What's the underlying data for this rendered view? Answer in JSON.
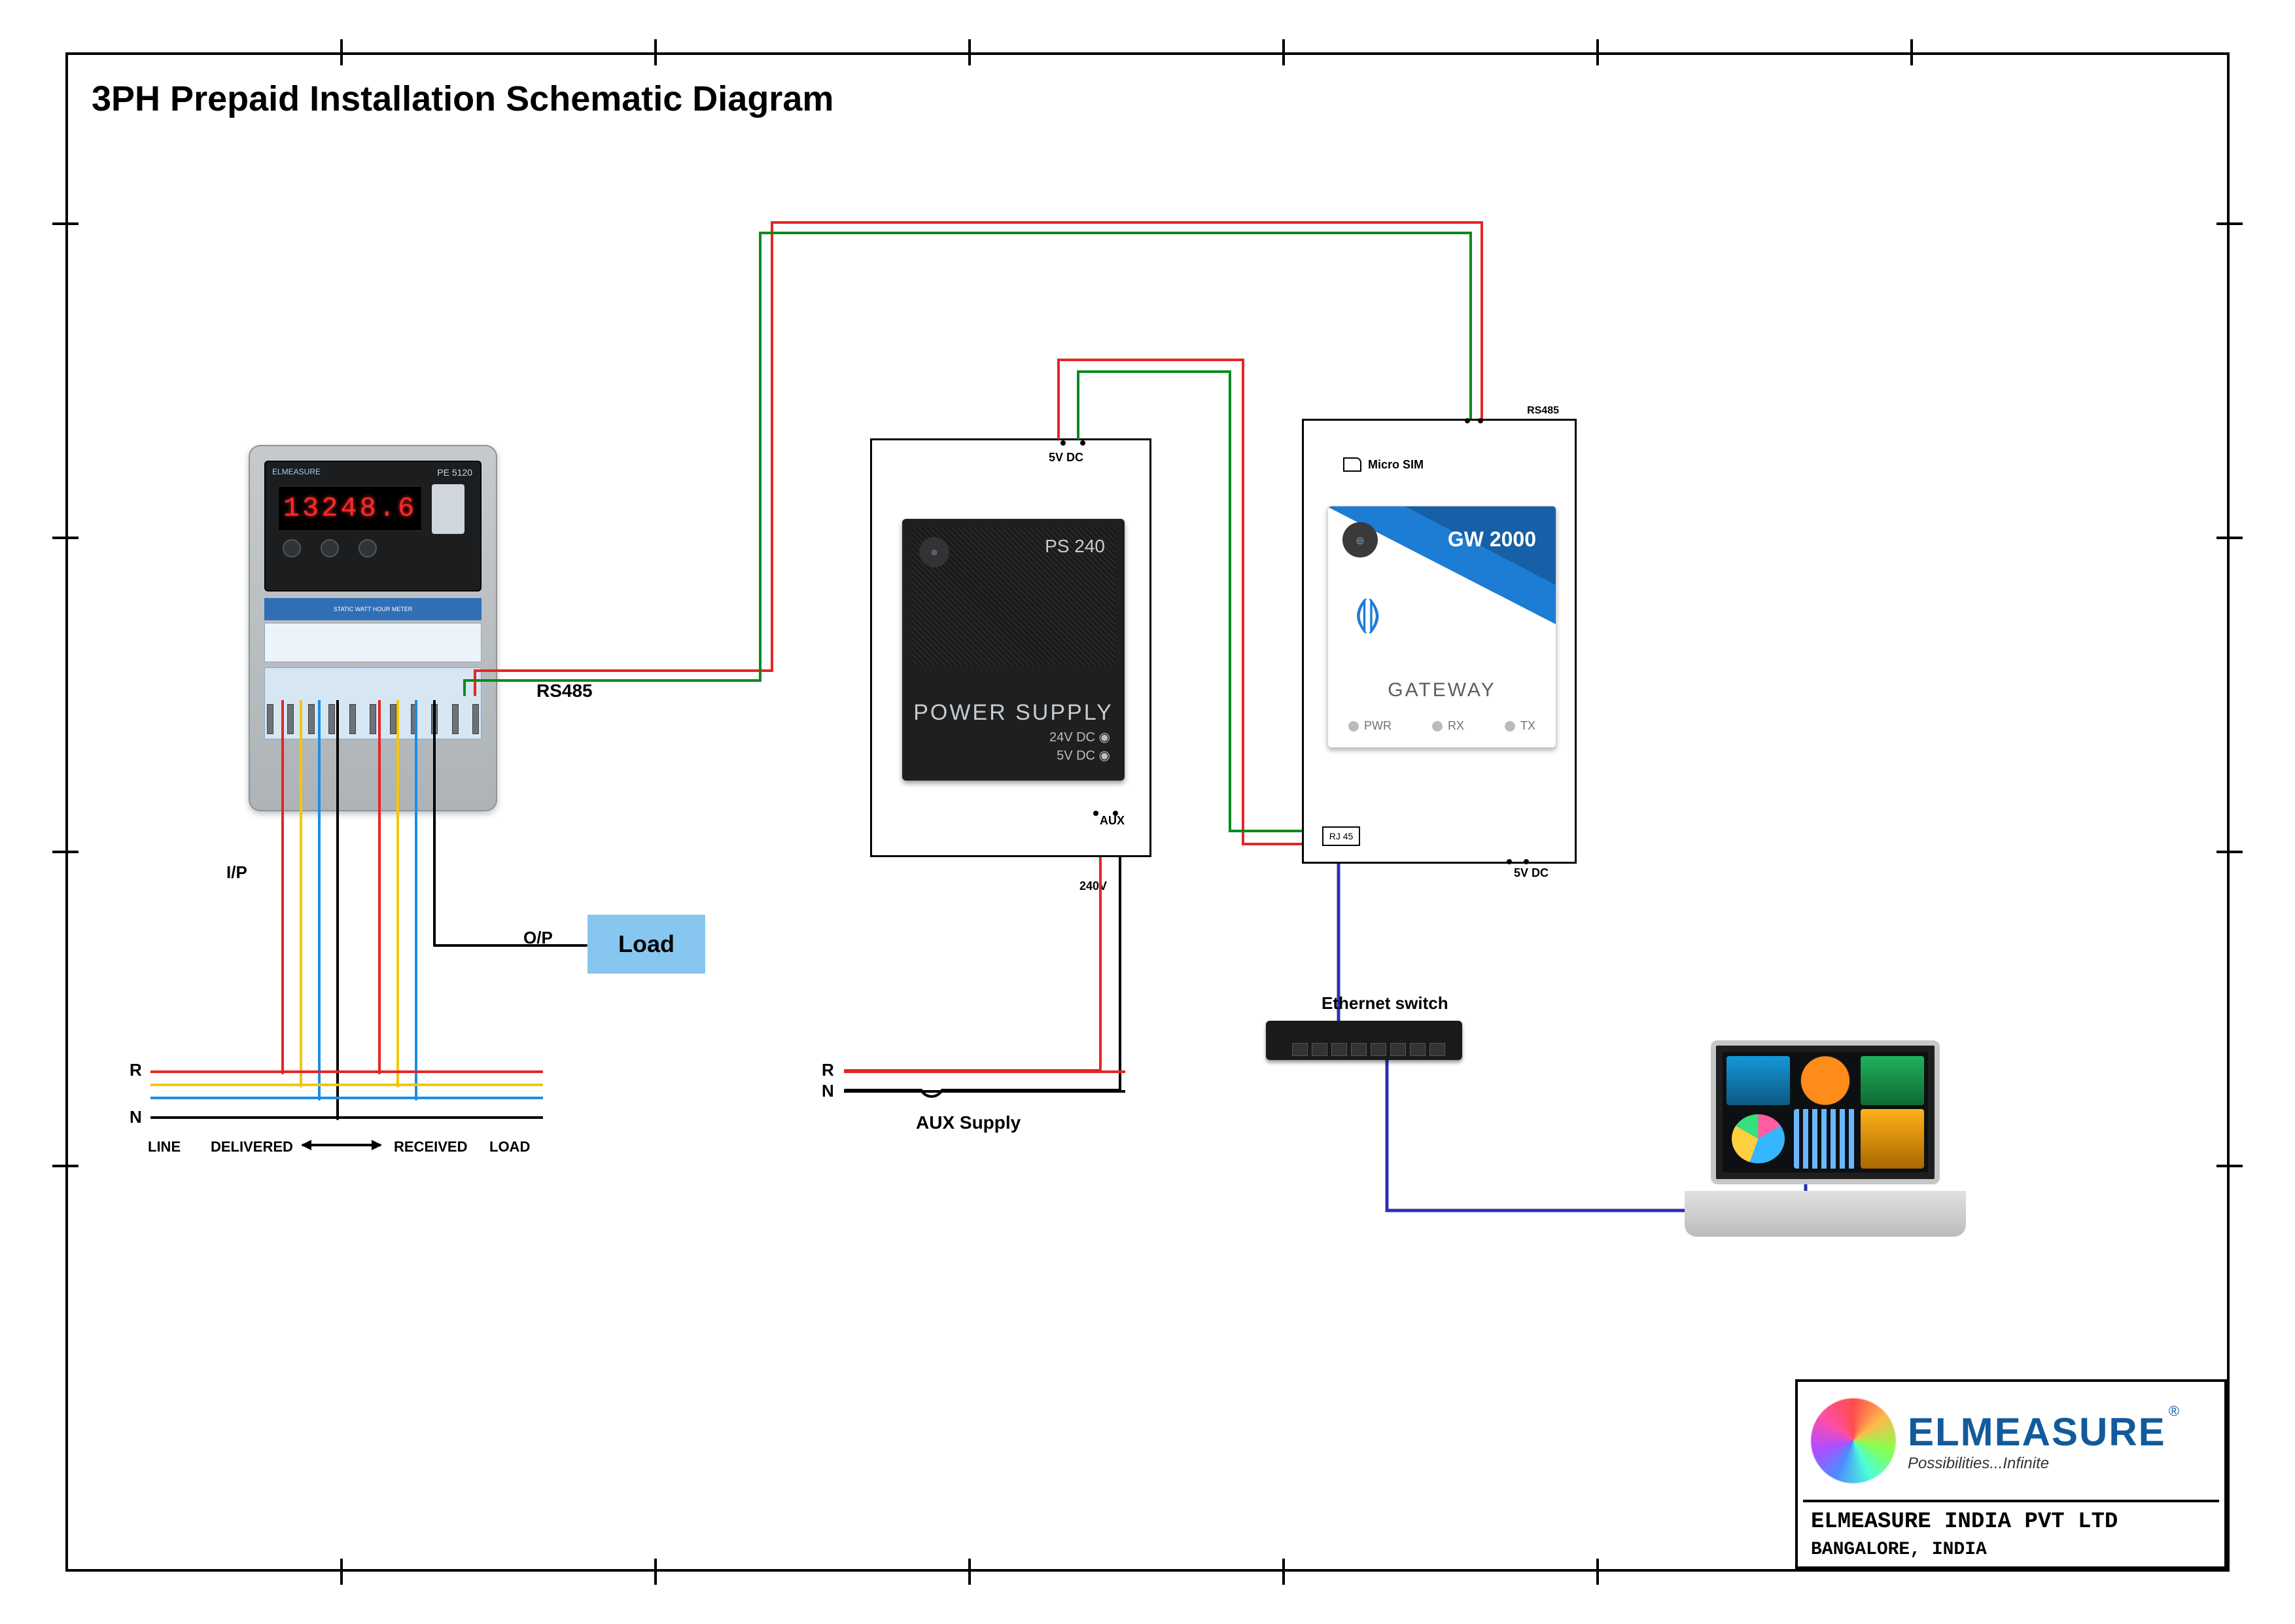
{
  "title": "3PH Prepaid Installation Schematic Diagram",
  "meter": {
    "brand": "ELMEASURE",
    "model": "PE 5120",
    "reading": "13248.6",
    "band_text": "STATIC WATT HOUR METER",
    "io_in": "I/P",
    "io_out": "O/P"
  },
  "rs485_label": "RS485",
  "load_label": "Load",
  "bus_left": {
    "r": "R",
    "n": "N",
    "line": "LINE",
    "delivered": "DELIVERED",
    "received": "RECEIVED",
    "load": "LOAD"
  },
  "ps": {
    "enclosure_top": "5V DC",
    "model": "PS 240",
    "label": "POWER SUPPLY",
    "spec1": "24V DC",
    "spec2": "5V DC",
    "aux_port": "AUX",
    "bottom_v": "240V"
  },
  "aux_bus": {
    "r": "R",
    "n": "N",
    "label": "AUX Supply"
  },
  "gw": {
    "top_port": "RS485",
    "sim": "Micro SIM",
    "model": "GW 2000",
    "name": "GATEWAY",
    "led_pwr": "PWR",
    "led_rx": "RX",
    "led_tx": "TX",
    "rj45": "RJ 45",
    "dc": "5V DC"
  },
  "switch_label": "Ethernet switch",
  "company": {
    "name": "ELMEASURE",
    "tagline": "Possibilities...Infinite",
    "reg": "®",
    "full": "ELMEASURE INDIA PVT LTD",
    "loc": "BANGALORE, INDIA"
  },
  "colors": {
    "r_phase": "#e52626",
    "y_phase": "#f4c60a",
    "b_phase": "#1b8ee6",
    "black": "#000000",
    "green": "#0a8a1f",
    "indigo": "#2c2fb5"
  }
}
